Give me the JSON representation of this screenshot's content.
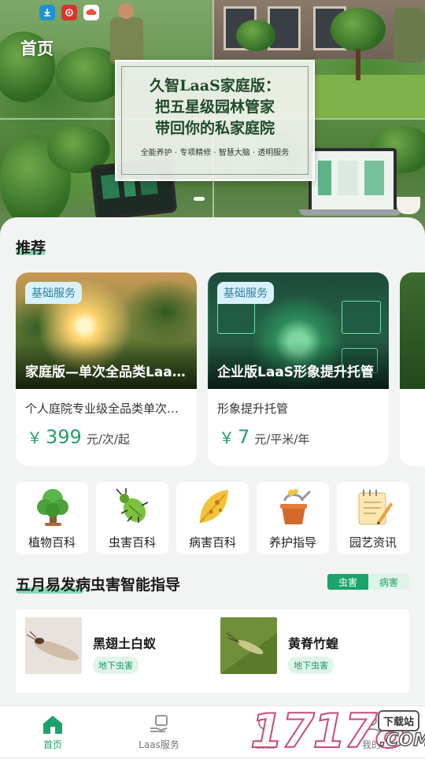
{
  "status_icons": [
    {
      "name": "download-icon",
      "color": "#1e90d6"
    },
    {
      "name": "app-icon",
      "color": "#d9342b"
    },
    {
      "name": "cloud-icon",
      "color": "#ffffff"
    }
  ],
  "hero": {
    "page_title": "首页",
    "banner_title": "久智LaaS家庭版：\n把五星级园林管家\n带回你的私家庭院",
    "banner_subtitle": "全能养护 · 专项精修 · 智慧大脑 · 透明服务"
  },
  "recommend": {
    "title": "推荐",
    "cards": [
      {
        "badge": "基础服务",
        "name": "家庭版—单次全品类LaaS服务",
        "desc": "个人庭院专业级全品类单次服务",
        "price_symbol": "￥",
        "price": "399",
        "unit": "元/次/起"
      },
      {
        "badge": "基础服务",
        "name": "企业版LaaS形象提升托管",
        "desc": "形象提升托管",
        "price_symbol": "￥",
        "price": "7",
        "unit": "元/平米/年"
      }
    ]
  },
  "categories": [
    {
      "label": "植物百科",
      "icon": "tree-icon"
    },
    {
      "label": "虫害百科",
      "icon": "bug-icon"
    },
    {
      "label": "病害百科",
      "icon": "leaf-icon"
    },
    {
      "label": "养护指导",
      "icon": "watering-can-icon"
    },
    {
      "label": "园艺资讯",
      "icon": "notepad-icon"
    }
  ],
  "guide": {
    "title": "五月易发病虫害智能指导",
    "tabs": [
      {
        "label": "虫害",
        "active": true
      },
      {
        "label": "病害",
        "active": false
      }
    ],
    "items": [
      {
        "name": "黑翅土白蚁",
        "tag": "地下虫害"
      },
      {
        "name": "黄脊竹蝗",
        "tag": "地下虫害"
      }
    ]
  },
  "nav": {
    "items": [
      {
        "label": "首页",
        "icon": "home-icon",
        "active": true
      },
      {
        "label": "Laas服务",
        "icon": "service-hand-icon",
        "active": false
      },
      {
        "label": "爱园",
        "icon": "garden-icon",
        "active": false
      },
      {
        "label": "我的",
        "icon": "user-icon",
        "active": false
      }
    ]
  },
  "watermark": {
    "number": "17178",
    "badge": "下载站",
    "domain": ".COM"
  },
  "colors": {
    "accent": "#1aa36a",
    "price": "#22a06b",
    "badge_bg": "#d8f1fb",
    "badge_text": "#2e7fa3"
  }
}
